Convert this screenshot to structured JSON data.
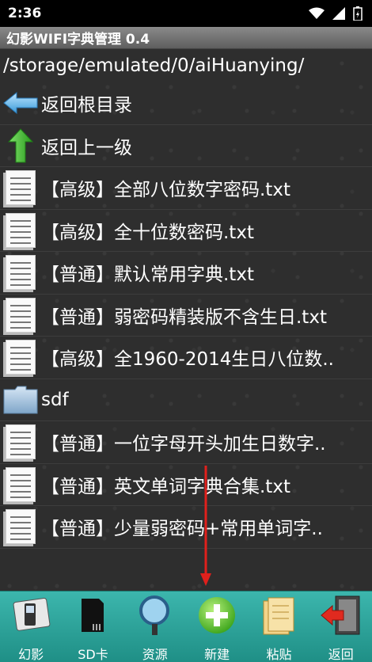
{
  "status": {
    "time": "2:36"
  },
  "app": {
    "title": "幻影WIFI字典管理 0.4"
  },
  "path": "/storage/emulated/0/aiHuanying/",
  "rows": [
    {
      "type": "nav-root",
      "label": "返回根目录"
    },
    {
      "type": "nav-up",
      "label": "返回上一级"
    },
    {
      "type": "file",
      "label": "【高级】全部八位数字密码.txt"
    },
    {
      "type": "file",
      "label": "【高级】全十位数密码.txt"
    },
    {
      "type": "file",
      "label": "【普通】默认常用字典.txt"
    },
    {
      "type": "file",
      "label": "【普通】弱密码精装版不含生日.txt"
    },
    {
      "type": "file",
      "label": "【高级】全1960-2014生日八位数.."
    },
    {
      "type": "folder",
      "label": "sdf"
    },
    {
      "type": "file",
      "label": "【普通】一位字母开头加生日数字.."
    },
    {
      "type": "file",
      "label": "【普通】英文单词字典合集.txt"
    },
    {
      "type": "file",
      "label": "【普通】少量弱密码+常用单词字.."
    }
  ],
  "toolbar": {
    "items": [
      {
        "label": "幻影",
        "icon": "phone-icon"
      },
      {
        "label": "SD卡",
        "icon": "sd-card-icon"
      },
      {
        "label": "资源",
        "icon": "magnifier-icon"
      },
      {
        "label": "新建",
        "icon": "add-icon"
      },
      {
        "label": "粘贴",
        "icon": "paste-icon"
      },
      {
        "label": "返回",
        "icon": "exit-icon"
      }
    ]
  },
  "colors": {
    "toolbar": "#2aa79e",
    "annotation_arrow": "#e0201c"
  }
}
